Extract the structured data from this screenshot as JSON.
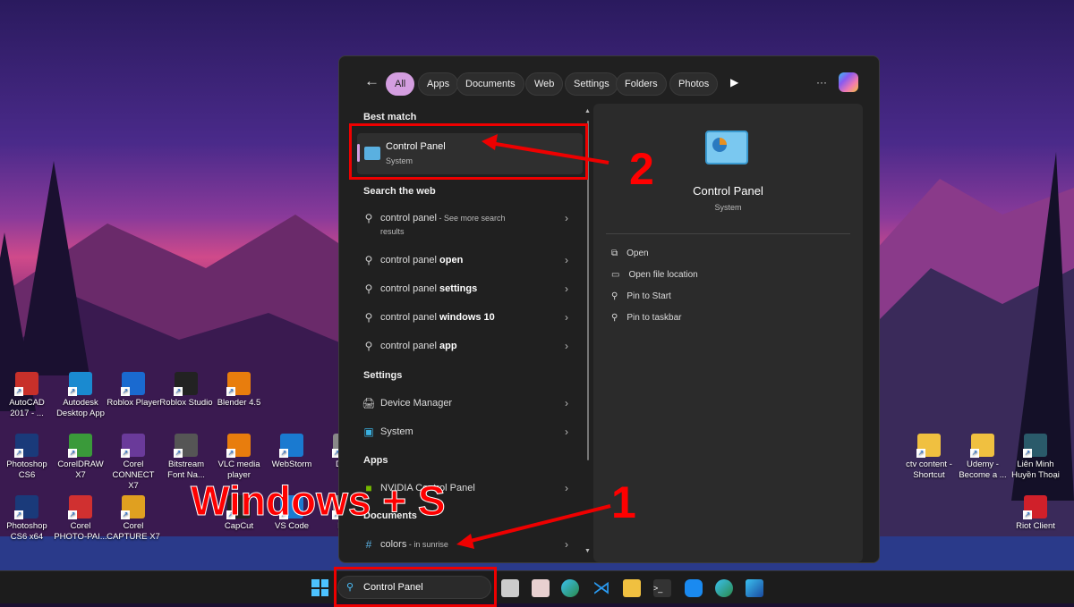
{
  "desktop": {
    "left_icons": [
      {
        "label": "AutoCAD 2017 - ...",
        "color": "#c8302a"
      },
      {
        "label": "Autodesk Desktop App",
        "color": "#1a8ad0"
      },
      {
        "label": "Roblox Player",
        "color": "#1a6ad0"
      },
      {
        "label": "Roblox Studio",
        "color": "#222"
      },
      {
        "label": "Blender 4.5",
        "color": "#e87d0d"
      },
      {
        "label": "Photoshop CS6",
        "color": "#1a3a7a"
      },
      {
        "label": "CorelDRAW X7",
        "color": "#3a9a3a"
      },
      {
        "label": "Corel CONNECT X7",
        "color": "#6a3a9a"
      },
      {
        "label": "Bitstream Font Na...",
        "color": "#555"
      },
      {
        "label": "VLC media player",
        "color": "#e87d0d"
      },
      {
        "label": "WebStorm",
        "color": "#1a7ad0"
      },
      {
        "label": "Da...",
        "color": "#888"
      },
      {
        "label": "Photoshop CS6 x64",
        "color": "#1a3a7a"
      },
      {
        "label": "Corel PHOTO-PAI...",
        "color": "#d03030"
      },
      {
        "label": "Corel CAPTURE X7",
        "color": "#e0a020"
      },
      {
        "label": "CapCut",
        "color": "#222"
      },
      {
        "label": "VS Code",
        "color": "#1a7ad0"
      },
      {
        "label": "Fi...",
        "color": "#888"
      }
    ],
    "right_icons": [
      {
        "label": "ctv content - Shortcut",
        "color": "#f0c040"
      },
      {
        "label": "Udemy - Become a ...",
        "color": "#f0c040"
      },
      {
        "label": "Liên Minh Huyền Thoại",
        "color": "#2a5a6a"
      },
      {
        "label": "Riot Client",
        "color": "#d0202a"
      }
    ]
  },
  "search": {
    "filters": [
      "All",
      "Apps",
      "Documents",
      "Web",
      "Settings",
      "Folders",
      "Photos"
    ],
    "more_label": "···",
    "best_match_heading": "Best match",
    "best_match": {
      "title": "Control Panel",
      "subtitle": "System"
    },
    "web_heading": "Search the web",
    "web_results": [
      {
        "prefix": "control panel",
        "bold": "",
        "suffix": " - See more search results"
      },
      {
        "prefix": "control panel ",
        "bold": "open",
        "suffix": ""
      },
      {
        "prefix": "control panel ",
        "bold": "settings",
        "suffix": ""
      },
      {
        "prefix": "control panel ",
        "bold": "windows 10",
        "suffix": ""
      },
      {
        "prefix": "control panel ",
        "bold": "app",
        "suffix": ""
      }
    ],
    "settings_heading": "Settings",
    "settings_results": [
      "Device Manager",
      "System"
    ],
    "apps_heading": "Apps",
    "apps_results": [
      "NVIDIA Control Panel"
    ],
    "documents_heading": "Documents",
    "documents_results": [
      {
        "name": "colors",
        "suffix": " - in sunrise"
      }
    ],
    "preview": {
      "title": "Control Panel",
      "subtitle": "System",
      "actions": [
        "Open",
        "Open file location",
        "Pin to Start",
        "Pin to taskbar"
      ]
    }
  },
  "taskbar": {
    "search_value": "Control Panel"
  },
  "annotations": {
    "shortcut": "Windows + S",
    "step1": "1",
    "step2": "2",
    "color": "#ff0000"
  }
}
